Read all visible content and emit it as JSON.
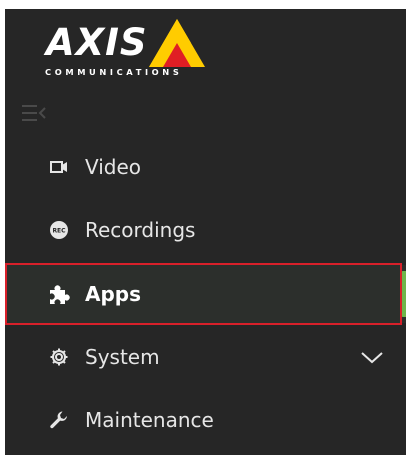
{
  "logo": {
    "wordmark": "AXIS",
    "subtitle": "COMMUNICATIONS",
    "triangle_color": "#ffcc00",
    "accent_color": "#e01e24"
  },
  "sidebar": {
    "collapse_icon": "collapse-menu-icon",
    "active_color": "#6fb54a",
    "highlight_color": "#d8202a",
    "items": [
      {
        "id": "video",
        "label": "Video",
        "icon": "video-camera-icon",
        "active": false,
        "expandable": false
      },
      {
        "id": "recordings",
        "label": "Recordings",
        "icon": "rec-icon",
        "icon_text": "REC",
        "active": false,
        "expandable": false
      },
      {
        "id": "apps",
        "label": "Apps",
        "icon": "puzzle-icon",
        "active": true,
        "expandable": false
      },
      {
        "id": "system",
        "label": "System",
        "icon": "gear-icon",
        "active": false,
        "expandable": true
      },
      {
        "id": "maintenance",
        "label": "Maintenance",
        "icon": "wrench-icon",
        "active": false,
        "expandable": false
      }
    ]
  }
}
